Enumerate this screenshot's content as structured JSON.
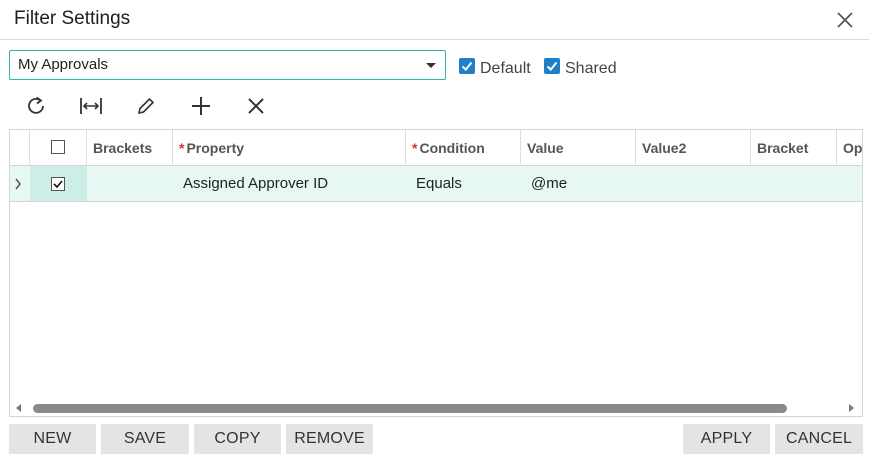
{
  "dialog": {
    "title": "Filter Settings",
    "close_icon": "close-icon"
  },
  "filter_select": {
    "value": "My Approvals"
  },
  "checkboxes": {
    "default": {
      "label": "Default",
      "checked": true
    },
    "shared": {
      "label": "Shared",
      "checked": true
    }
  },
  "toolbar": {
    "icons": [
      "refresh-icon",
      "fit-columns-icon",
      "edit-icon",
      "add-icon",
      "delete-icon"
    ]
  },
  "grid": {
    "columns": {
      "brackets": "Brackets",
      "property": "Property",
      "condition": "Condition",
      "value": "Value",
      "value2": "Value2",
      "bracket": "Bracket",
      "operator": "Operator"
    },
    "required_marker": "*",
    "rows": [
      {
        "active": true,
        "checked": true,
        "brackets": "",
        "property": "Assigned Approver ID",
        "condition": "Equals",
        "value": "@me",
        "value2": "",
        "bracket": ""
      }
    ]
  },
  "buttons": {
    "new": "NEW",
    "save": "SAVE",
    "copy": "COPY",
    "remove": "REMOVE",
    "apply": "APPLY",
    "cancel": "CANCEL"
  },
  "colors": {
    "accent": "#1f7fc8",
    "select_border": "#2bb8a8",
    "row_highlight": "#e6f7f4",
    "required": "#d32f2f"
  }
}
